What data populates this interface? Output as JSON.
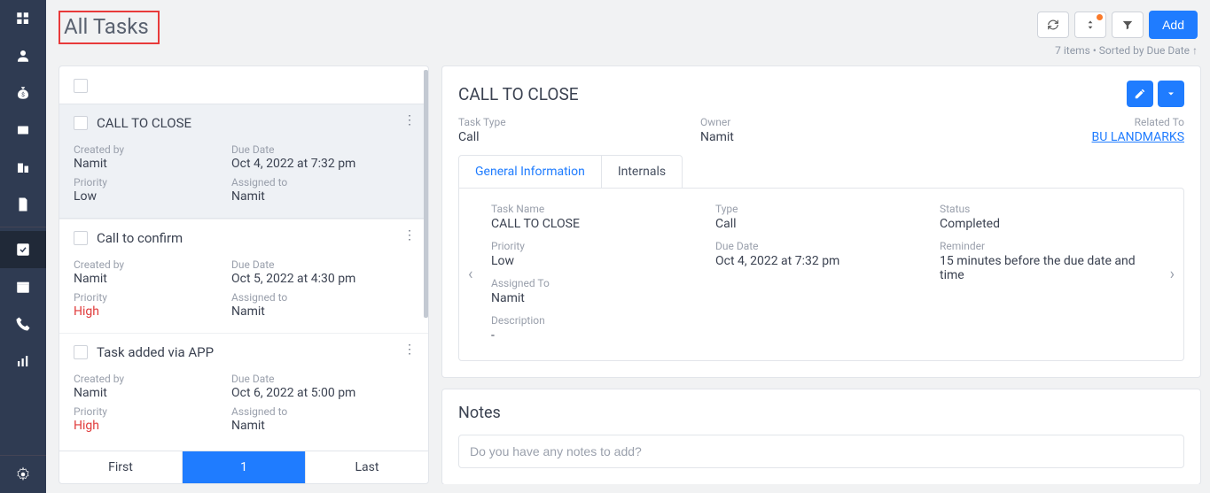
{
  "page_title": "All Tasks",
  "header": {
    "add_label": "Add",
    "meta": "7 items • Sorted by Due Date ↑"
  },
  "task_list": {
    "tasks": [
      {
        "title": "CALL TO CLOSE",
        "created_by_label": "Created by",
        "created_by": "Namit",
        "due_date_label": "Due Date",
        "due_date": "Oct 4, 2022 at 7:32 pm",
        "priority_label": "Priority",
        "priority": "Low",
        "assigned_to_label": "Assigned to",
        "assigned_to": "Namit",
        "selected": true,
        "priority_class": ""
      },
      {
        "title": "Call to confirm",
        "created_by_label": "Created by",
        "created_by": "Namit",
        "due_date_label": "Due Date",
        "due_date": "Oct 5, 2022 at 4:30 pm",
        "priority_label": "Priority",
        "priority": "High",
        "assigned_to_label": "Assigned to",
        "assigned_to": "Namit",
        "selected": false,
        "priority_class": "red"
      },
      {
        "title": "Task added via APP",
        "created_by_label": "Created by",
        "created_by": "Namit",
        "due_date_label": "Due Date",
        "due_date": "Oct 6, 2022 at 5:00 pm",
        "priority_label": "Priority",
        "priority": "High",
        "assigned_to_label": "Assigned to",
        "assigned_to": "Namit",
        "selected": false,
        "priority_class": "red"
      }
    ],
    "pagination": {
      "first": "First",
      "page": "1",
      "last": "Last"
    }
  },
  "detail": {
    "title": "CALL TO CLOSE",
    "summary": {
      "task_type_label": "Task Type",
      "task_type": "Call",
      "owner_label": "Owner",
      "owner": "Namit",
      "related_to_label": "Related To",
      "related_to": "BU LANDMARKS"
    },
    "tabs": {
      "general": "General Information",
      "internals": "Internals"
    },
    "fields": {
      "task_name_label": "Task Name",
      "task_name": "CALL TO CLOSE",
      "type_label": "Type",
      "type": "Call",
      "status_label": "Status",
      "status": "Completed",
      "priority_label": "Priority",
      "priority": "Low",
      "due_date_label": "Due Date",
      "due_date": "Oct 4, 2022 at 7:32 pm",
      "reminder_label": "Reminder",
      "reminder": "15 minutes before the due date and time",
      "assigned_to_label": "Assigned To",
      "assigned_to": "Namit",
      "description_label": "Description",
      "description": "-"
    }
  },
  "notes": {
    "title": "Notes",
    "placeholder": "Do you have any notes to add?"
  }
}
